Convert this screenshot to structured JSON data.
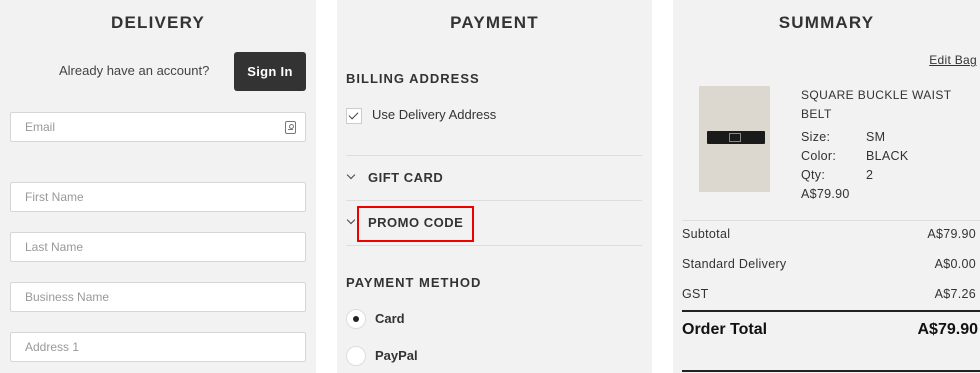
{
  "delivery": {
    "title": "DELIVERY",
    "account_prompt": "Already have an account?",
    "sign_in_label": "Sign In",
    "fields": {
      "email_placeholder": "Email",
      "first_name_placeholder": "First Name",
      "last_name_placeholder": "Last Name",
      "business_name_placeholder": "Business Name",
      "address1_placeholder": "Address 1"
    }
  },
  "payment": {
    "title": "PAYMENT",
    "billing_heading": "BILLING ADDRESS",
    "use_delivery_label": "Use Delivery Address",
    "use_delivery_checked": true,
    "gift_card_label": "GIFT CARD",
    "promo_code_label": "PROMO CODE",
    "method_heading": "PAYMENT METHOD",
    "methods": [
      {
        "label": "Card",
        "selected": true
      },
      {
        "label": "PayPal",
        "selected": false
      }
    ],
    "highlight_color": "#e00000"
  },
  "summary": {
    "title": "SUMMARY",
    "edit_bag": "Edit Bag",
    "product": {
      "name": "SQUARE BUCKLE WAIST BELT",
      "size_label": "Size:",
      "size": "SM",
      "color_label": "Color:",
      "color": "BLACK",
      "qty_label": "Qty:",
      "qty": "2",
      "price": "A$79.90"
    },
    "subtotal_label": "Subtotal",
    "subtotal": "A$79.90",
    "delivery_label": "Standard Delivery",
    "delivery": "A$0.00",
    "gst_label": "GST",
    "gst": "A$7.26",
    "total_label": "Order Total",
    "total": "A$79.90"
  }
}
